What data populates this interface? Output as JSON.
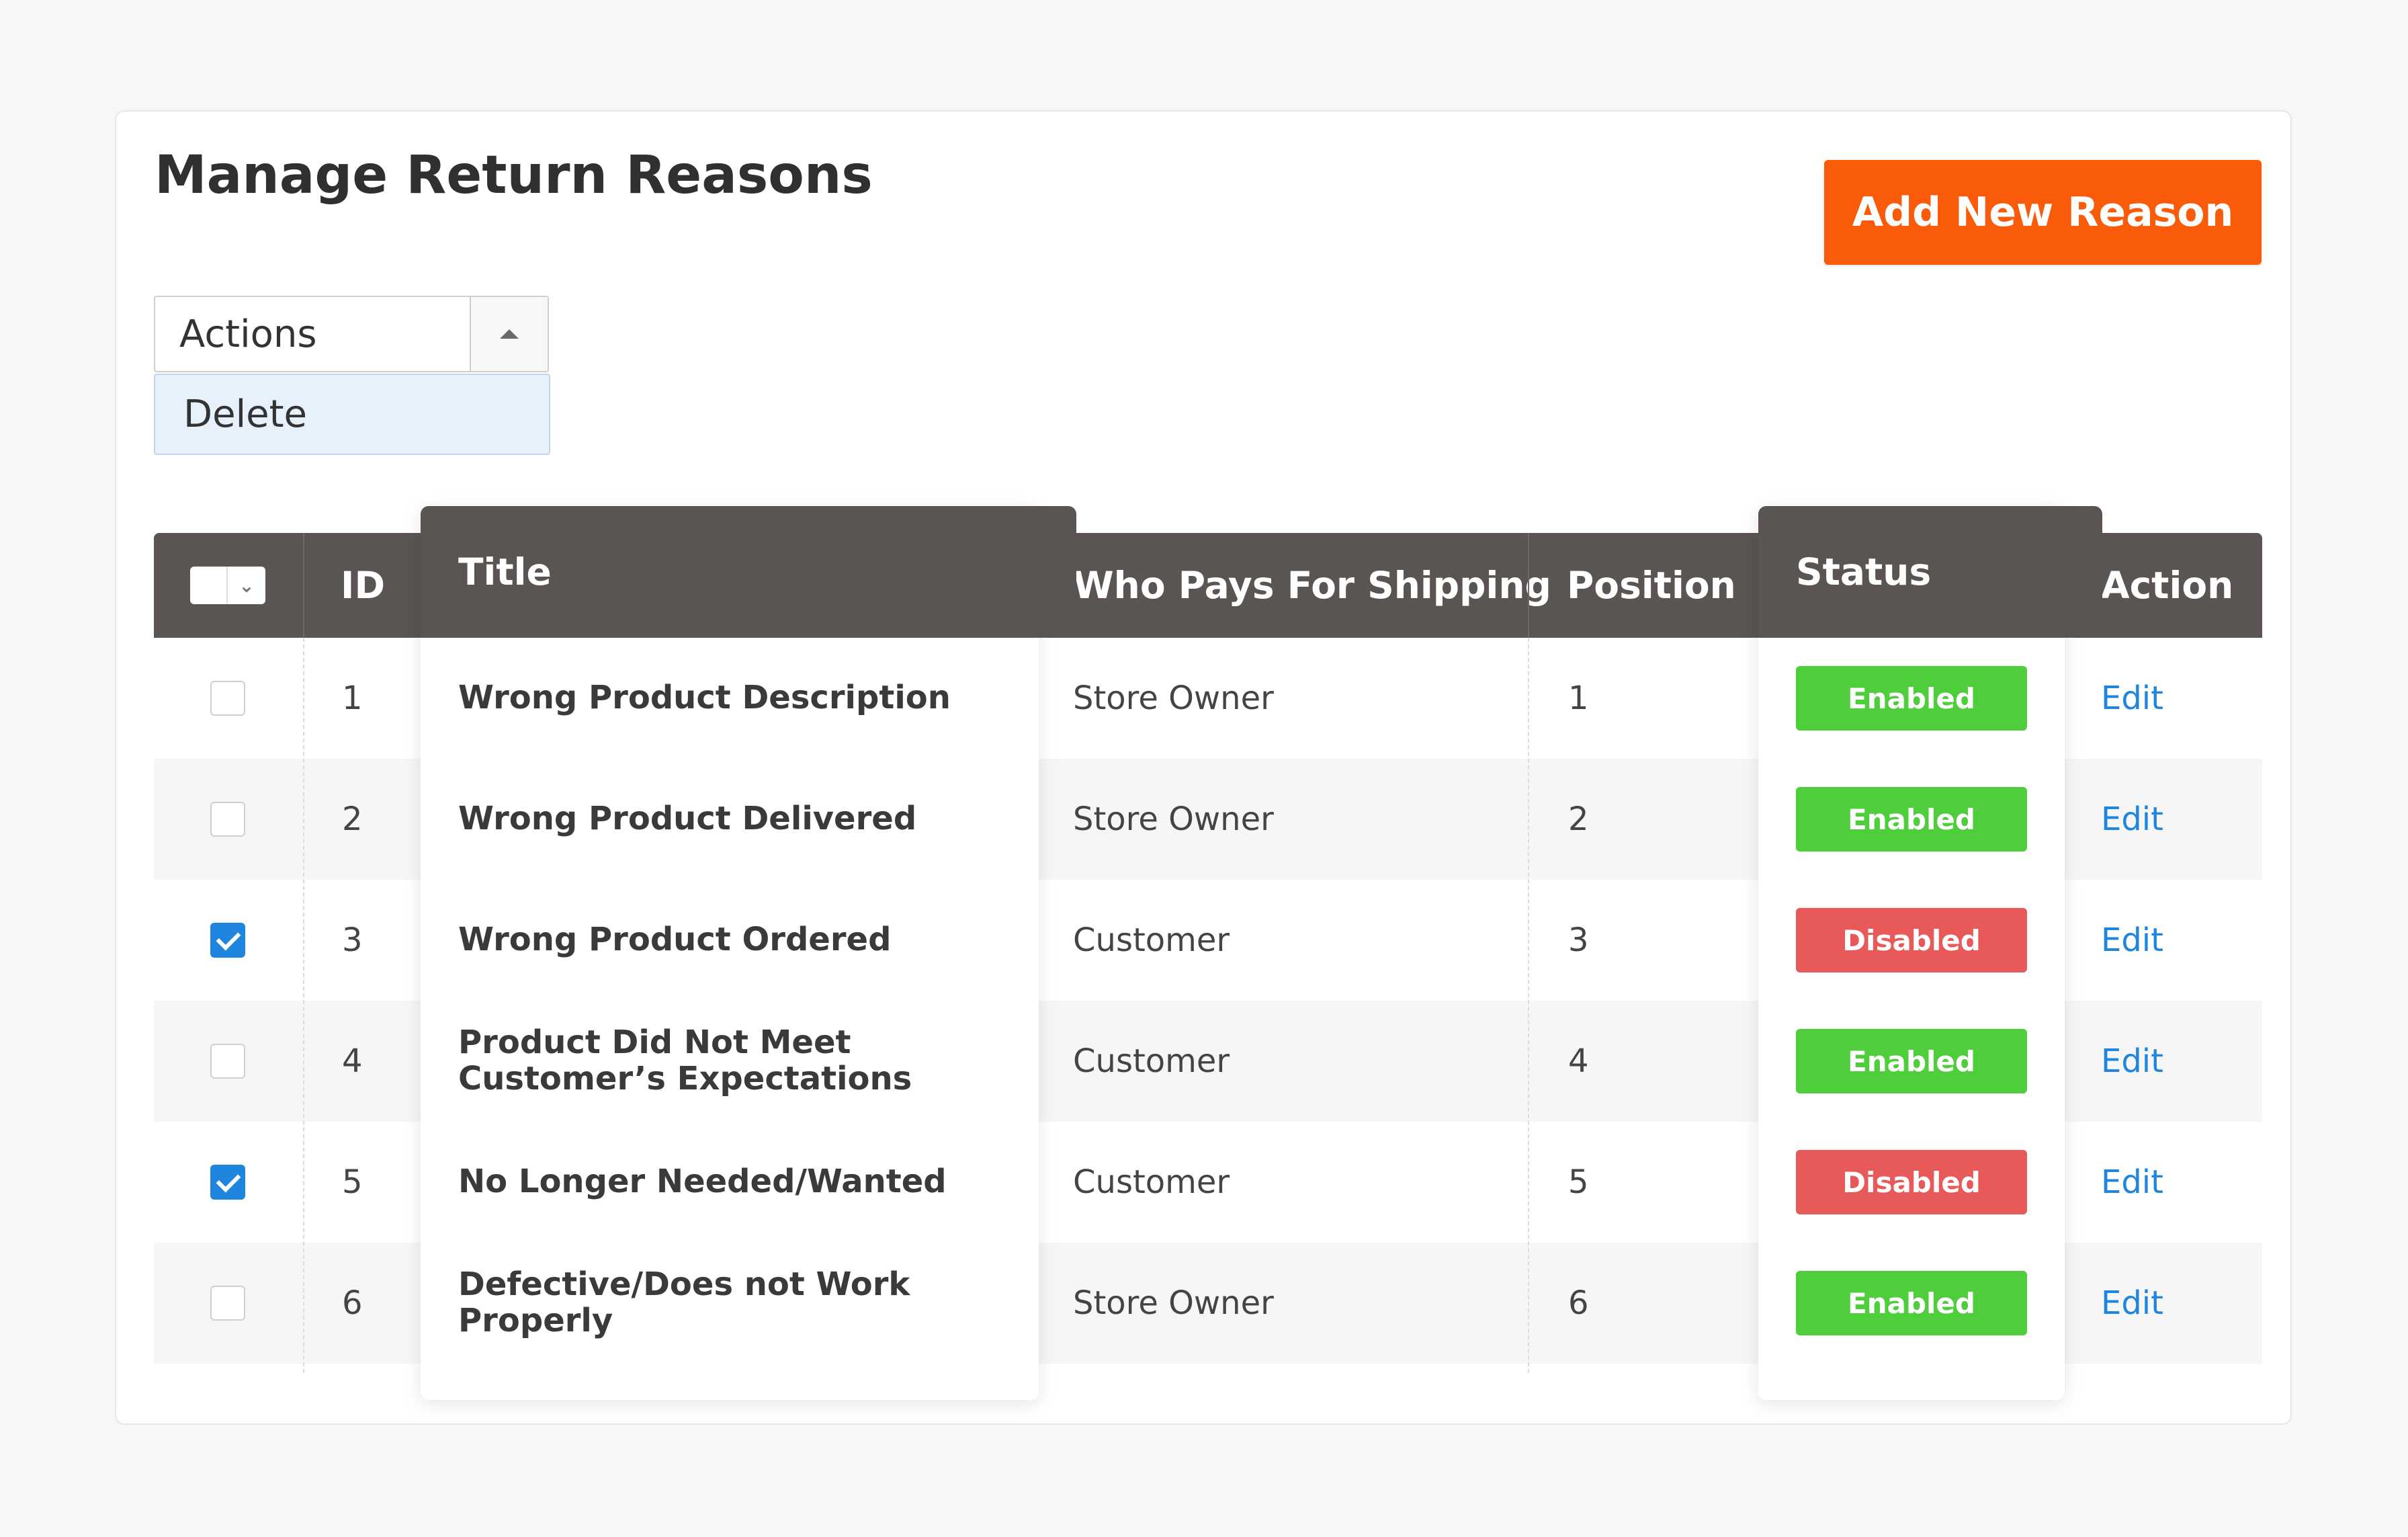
{
  "page": {
    "title": "Manage Return Reasons",
    "add_button_label": "Add New Reason"
  },
  "actions": {
    "label": "Actions",
    "menu_items": [
      "Delete"
    ]
  },
  "colors": {
    "header_bg": "#5a5552",
    "accent": "#fa5b0b",
    "enabled": "#4fce3c",
    "disabled": "#e85959",
    "link": "#1f86e0"
  },
  "table": {
    "headers": {
      "id": "ID",
      "title": "Title",
      "who_pays": "Who Pays For Shipping",
      "position": "Position",
      "status": "Status",
      "action": "Action"
    },
    "rows": [
      {
        "checked": false,
        "id": "1",
        "title": "Wrong Product Description",
        "who_pays": "Store Owner",
        "position": "1",
        "status": "Enabled",
        "action": "Edit"
      },
      {
        "checked": false,
        "id": "2",
        "title": "Wrong Product Delivered",
        "who_pays": "Store Owner",
        "position": "2",
        "status": "Enabled",
        "action": "Edit"
      },
      {
        "checked": true,
        "id": "3",
        "title": "Wrong Product Ordered",
        "who_pays": "Customer",
        "position": "3",
        "status": "Disabled",
        "action": "Edit"
      },
      {
        "checked": false,
        "id": "4",
        "title": "Product Did Not Meet Customer’s Expectations",
        "who_pays": "Customer",
        "position": "4",
        "status": "Enabled",
        "action": "Edit"
      },
      {
        "checked": true,
        "id": "5",
        "title": "No Longer Needed/Wanted",
        "who_pays": "Customer",
        "position": "5",
        "status": "Disabled",
        "action": "Edit"
      },
      {
        "checked": false,
        "id": "6",
        "title": "Defective/Does not Work Properly",
        "who_pays": "Store Owner",
        "position": "6",
        "status": "Enabled",
        "action": "Edit"
      }
    ]
  }
}
